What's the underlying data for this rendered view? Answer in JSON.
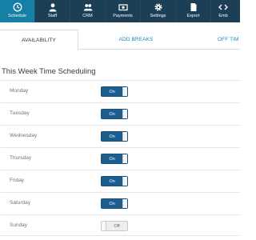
{
  "nav": {
    "items": [
      {
        "label": "Schedule",
        "icon": "schedule-icon",
        "active": true
      },
      {
        "label": "Staff",
        "icon": "staff-icon",
        "active": false
      },
      {
        "label": "CRM",
        "icon": "crm-icon",
        "active": false
      },
      {
        "label": "Payments",
        "icon": "payments-icon",
        "active": false
      },
      {
        "label": "Settings",
        "icon": "settings-icon",
        "active": false
      },
      {
        "label": "Export",
        "icon": "export-icon",
        "active": false
      },
      {
        "label": "Emb",
        "icon": "embed-icon",
        "active": false
      }
    ]
  },
  "tabs": {
    "availability": "AVAILABILITY",
    "add_breaks": "ADD BREAKS",
    "off_time": "OFF TIM"
  },
  "section": {
    "title": "This Week Time Scheduling"
  },
  "schedule": [
    {
      "day": "Monday",
      "state": "On"
    },
    {
      "day": "Tuesday",
      "state": "On"
    },
    {
      "day": "Wednesday",
      "state": "On"
    },
    {
      "day": "Thursday",
      "state": "On"
    },
    {
      "day": "Friday",
      "state": "On"
    },
    {
      "day": "Saturday",
      "state": "On"
    },
    {
      "day": "Sunday",
      "state": "Off"
    }
  ],
  "colors": {
    "nav_bg": "#1c3f56",
    "nav_active": "#167fa5",
    "toggle_on": "#1b5e8e",
    "link": "#1f84c6"
  }
}
